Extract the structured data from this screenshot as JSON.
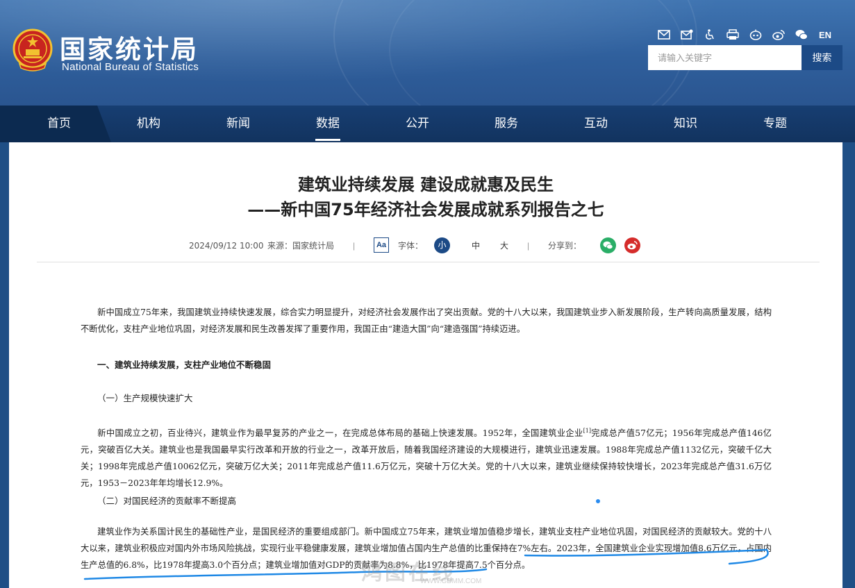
{
  "header": {
    "logo_cn": "国家统计局",
    "logo_en": "National Bureau of Statistics",
    "tool_icons": [
      "mail-icon",
      "mailbox-icon",
      "accessibility-icon",
      "print-icon",
      "robot-icon",
      "weibo-icon",
      "wechat-icon"
    ],
    "lang": "EN",
    "search_placeholder": "请输入关键字",
    "search_button": "搜索"
  },
  "nav": {
    "items": [
      "首页",
      "机构",
      "新闻",
      "数据",
      "公开",
      "服务",
      "互动",
      "知识",
      "专题"
    ],
    "active": "数据"
  },
  "article": {
    "title_line1": "建筑业持续发展 建设成就惠及民生",
    "title_line2": "——新中国75年经济社会发展成就系列报告之七",
    "date": "2024/09/12 10:00",
    "source": "来源：国家统计局",
    "font_label": "字体：",
    "font_small": "小",
    "font_medium": "中",
    "font_large": "大",
    "share_label": "分享到：",
    "aa": "Aa",
    "sep": "|",
    "p1": "新中国成立75年来，我国建筑业持续快速发展，综合实力明显提升，对经济社会发展作出了突出贡献。党的十八大以来，我国建筑业步入新发展阶段，生产转向高质量发展，结构不断优化，支柱产业地位巩固，对经济发展和民生改善发挥了重要作用，我国正由“建造大国”向“建造强国”持续迈进。",
    "h1": "一、建筑业持续发展，支柱产业地位不断稳固",
    "h2": "（一）生产规模快速扩大",
    "p2a": "新中国成立之初，百业待兴，建筑业作为最早复苏的产业之一，在完成总体布局的基础上快速发展。1952年，全国建筑业企业",
    "p2sup": "[1]",
    "p2b": "完成总产值57亿元；1956年完成总产值146亿元，突破百亿大关。建筑业也是我国最早实行改革和开放的行业之一，改革开放后，随着我国经济建设的大规模进行，建筑业迅速发展。1988年完成总产值1132亿元，突破千亿大关；1998年完成总产值10062亿元，突破万亿大关；2011年完成总产值11.6万亿元，突破十万亿大关。党的十八大以来，建筑业继续保持较快增长，2023年完成总产值31.6万亿元，1953－2023年年均增长12.9%。",
    "h3": "（二）对国民经济的贡献率不断提高",
    "p3": "建筑业作为关系国计民生的基础性产业，是国民经济的重要组成部门。新中国成立75年来，建筑业增加值稳步增长，建筑业支柱产业地位巩固，对国民经济的贡献较大。党的十八大以来，建筑业积极应对国内外市场风险挑战，实现行业平稳健康发展，建筑业增加值占国内生产总值的比重保持在7%左右。2023年，全国建筑业企业实现增加值8.6万亿元，占国内生产总值的6.8%，比1978年提高3.0个百分点；建筑业增加值对GDP的贡献率为8.8%，比1978年提高7.5个百分点。"
  },
  "watermark": "鸿图在线",
  "watermark_url": "WWW.GDMM.COM",
  "colors": {
    "brand_blue": "#1c4a86",
    "nav_bg": "#173e72",
    "annotation_blue": "#1e88e5",
    "wechat_green": "#2aae67",
    "weibo_red": "#d52c2b"
  }
}
